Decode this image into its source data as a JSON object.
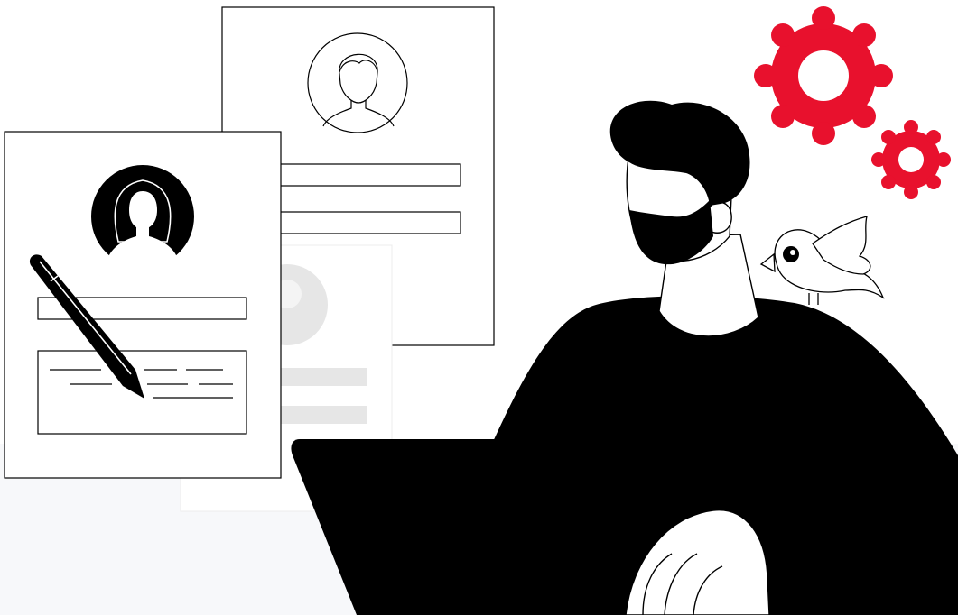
{
  "illustration": {
    "theme": "recruitment / resume review",
    "colors": {
      "background": "#ffffff",
      "floor": "#f7f8fa",
      "ink": "#000000",
      "accent": "#e8112d",
      "faded": "#e6e6e6"
    },
    "icons": [
      "resume-document-icon",
      "profile-avatar-icon",
      "pencil-icon",
      "gear-icon",
      "bird-icon",
      "laptop-icon"
    ]
  }
}
